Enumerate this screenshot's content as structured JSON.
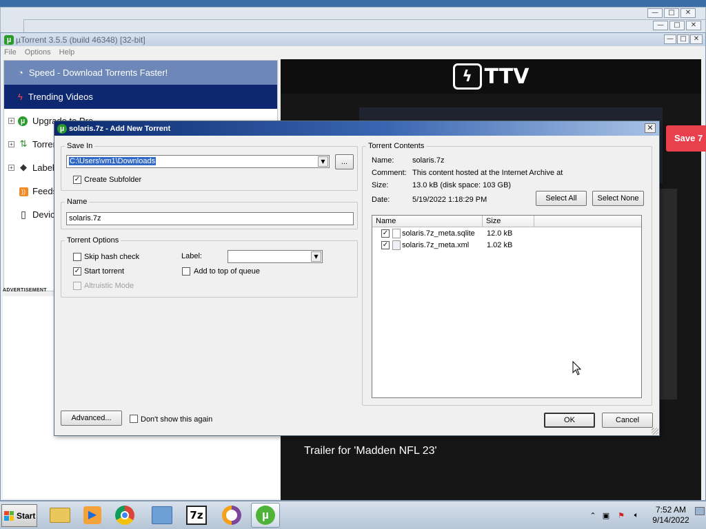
{
  "main_window": {
    "title": "µTorrent 3.5.5  (build 46348) [32-bit]",
    "menu": [
      "File",
      "Options",
      "Help"
    ],
    "controls": {
      "minimize": "—",
      "maximize": "□",
      "close": "✕"
    }
  },
  "sidebar": {
    "promo_speed": "Speed - Download Torrents Faster!",
    "promo_trending": "Trending Videos",
    "items": [
      {
        "label": "Upgrade to Pro",
        "icon": "utorrent-icon"
      },
      {
        "label": "Torrents",
        "icon": "transfer-icon"
      },
      {
        "label": "Labels",
        "icon": "tag-icon"
      },
      {
        "label": "Feeds",
        "icon": "rss-icon"
      },
      {
        "label": "Devices",
        "icon": "device-icon"
      }
    ],
    "ad_label": "ADVERTISEMENT"
  },
  "video": {
    "logo_text": "TTV",
    "save_label": "Save 7",
    "caption": "Trailer for 'Madden NFL 23'"
  },
  "dialog": {
    "title": "solaris.7z - Add New Torrent",
    "save_in": {
      "legend": "Save In",
      "path": "C:\\Users\\vm1\\Downloads",
      "browse_label": "...",
      "create_subfolder_label": "Create Subfolder",
      "create_subfolder_checked": true
    },
    "name": {
      "legend": "Name",
      "value": "solaris.7z"
    },
    "torrent_options": {
      "legend": "Torrent Options",
      "skip_hash_label": "Skip hash check",
      "skip_hash_checked": false,
      "start_torrent_label": "Start torrent",
      "start_torrent_checked": true,
      "altruistic_label": "Altruistic Mode",
      "altruistic_enabled": false,
      "label_label": "Label:",
      "label_value": "",
      "add_top_label": "Add to top of queue",
      "add_top_checked": false
    },
    "contents": {
      "legend": "Torrent Contents",
      "name_key": "Name:",
      "name_val": "solaris.7z",
      "comment_key": "Comment:",
      "comment_val": "This content hosted at the Internet Archive at",
      "size_key": "Size:",
      "size_val": "13.0 kB (disk space: 103 GB)",
      "date_key": "Date:",
      "date_val": "5/19/2022 1:18:29 PM",
      "select_all_label": "Select All",
      "select_none_label": "Select None",
      "columns": [
        "Name",
        "Size"
      ],
      "files": [
        {
          "name": "solaris.7z_meta.sqlite",
          "size": "12.0 kB",
          "checked": true
        },
        {
          "name": "solaris.7z_meta.xml",
          "size": "1.02 kB",
          "checked": true
        }
      ]
    },
    "advanced_label": "Advanced...",
    "dont_show_label": "Don't show this again",
    "dont_show_checked": false,
    "ok_label": "OK",
    "cancel_label": "Cancel",
    "close_label": "✕"
  },
  "taskbar": {
    "start_label": "Start",
    "apps": [
      "explorer-icon",
      "media-player-icon",
      "chrome-icon",
      "network-icon",
      "7zip-icon",
      "tor-browser-icon",
      "utorrent-icon"
    ],
    "sevenzip_text": "7z",
    "clock_time": "7:52 AM",
    "clock_date": "9/14/2022"
  },
  "colors": {
    "sidebar_speed_bg": "#6d87b8",
    "sidebar_trending_bg": "#0d2870",
    "save_button": "#e8414d",
    "dialog_title_start": "#0b2a6e",
    "selection": "#3169c6"
  }
}
